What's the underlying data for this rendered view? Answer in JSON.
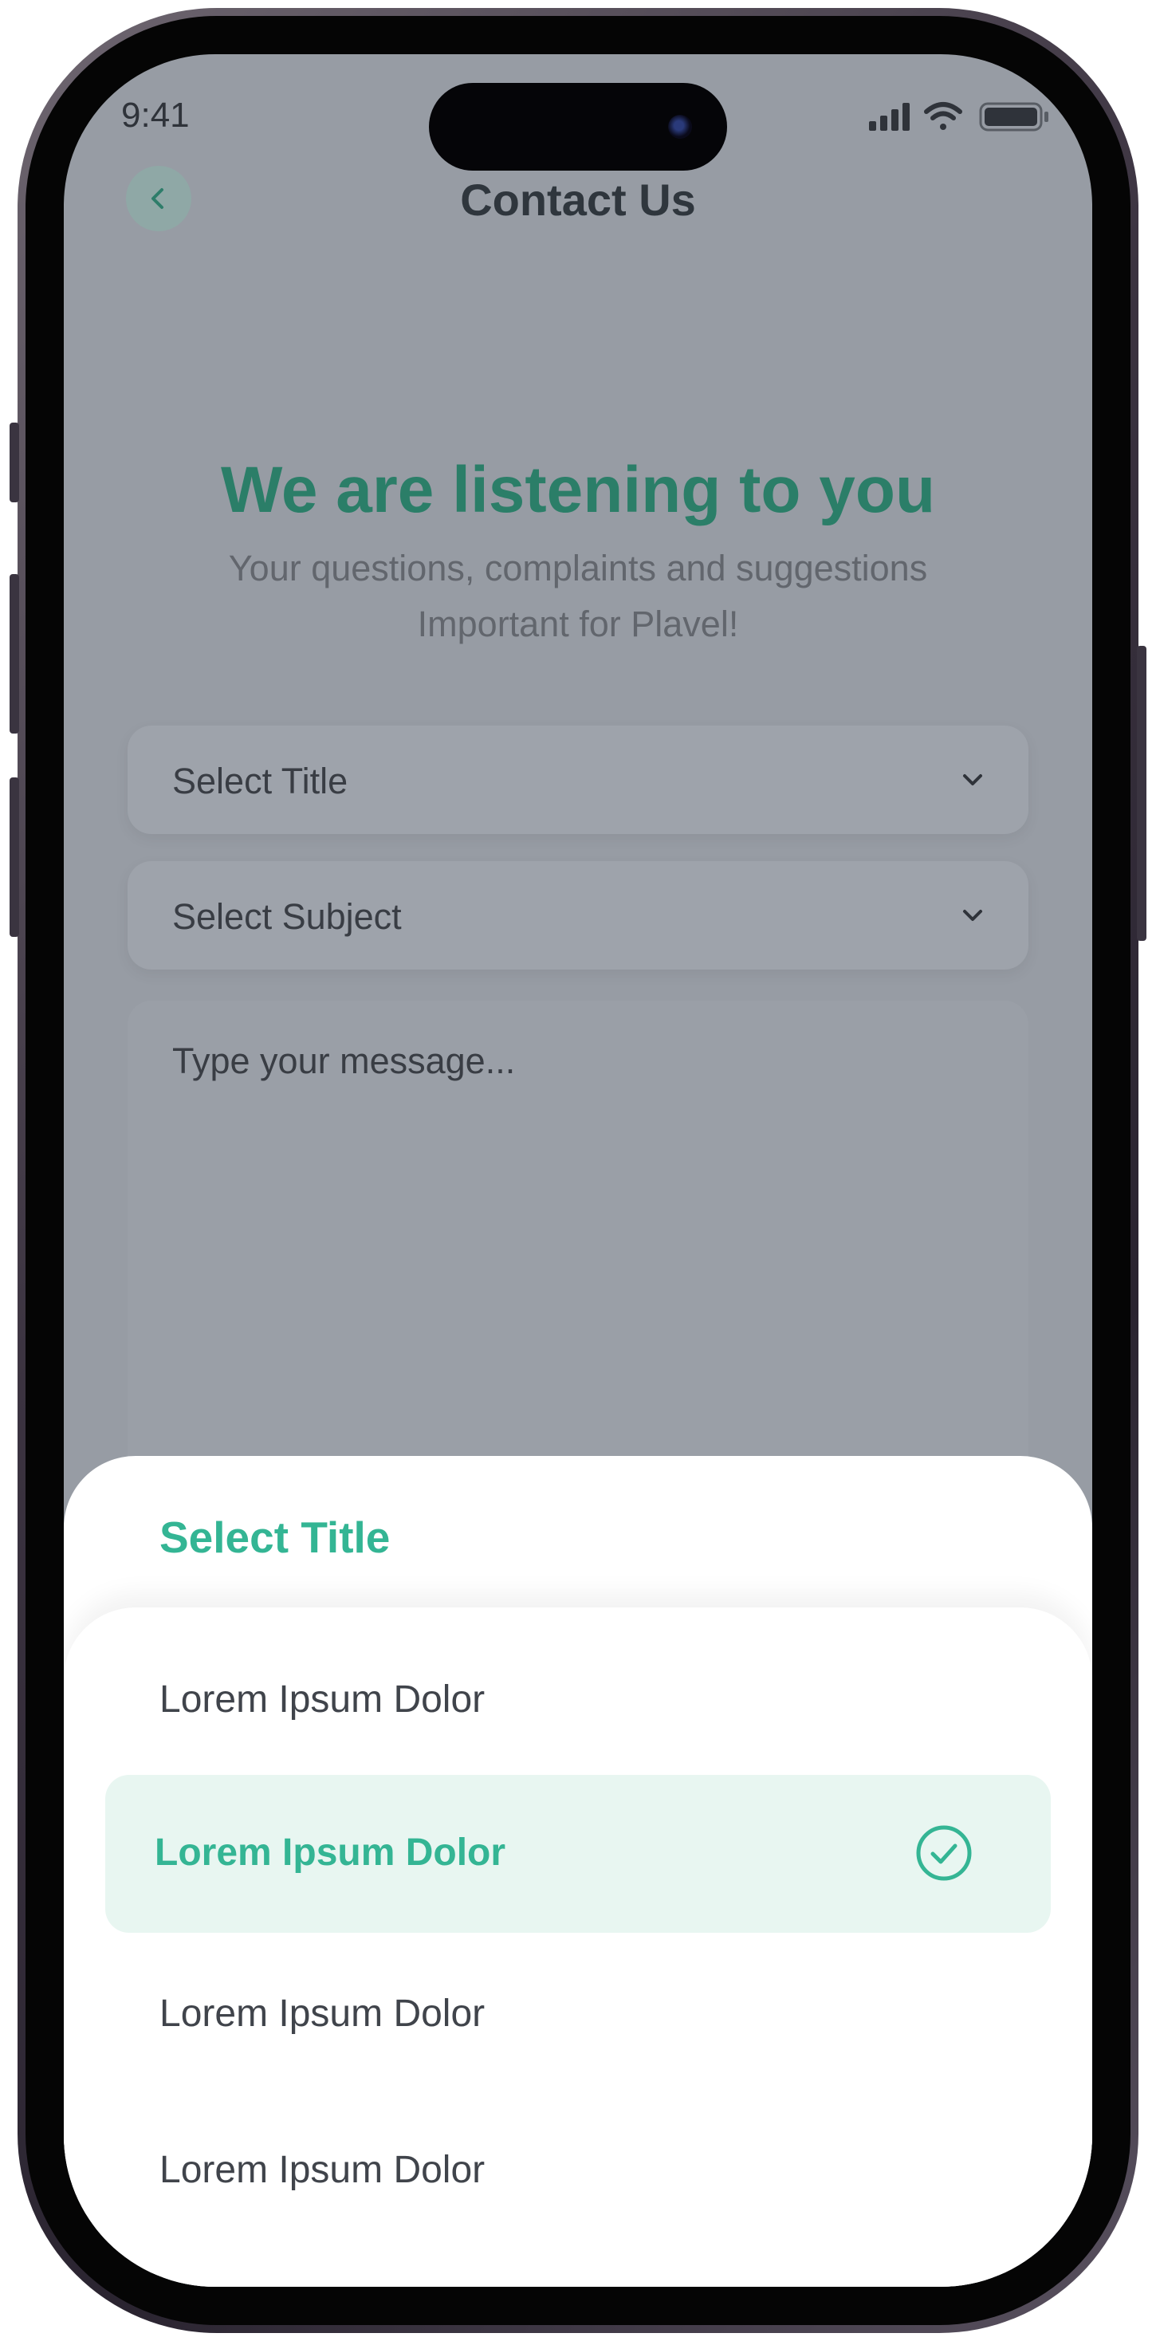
{
  "status_bar": {
    "time": "9:41"
  },
  "nav": {
    "title": "Contact Us"
  },
  "hero": {
    "title": "We are listening to you",
    "subtitle_line1": "Your questions, complaints and suggestions",
    "subtitle_line2": "Important for Plavel!"
  },
  "form": {
    "title_select": "Select Title",
    "subject_select": "Select Subject",
    "message_placeholder": "Type your message..."
  },
  "sheet": {
    "title": "Select Title",
    "options": [
      {
        "label": "Lorem Ipsum Dolor",
        "selected": false
      },
      {
        "label": "Lorem Ipsum Dolor",
        "selected": true
      },
      {
        "label": "Lorem Ipsum Dolor",
        "selected": false
      },
      {
        "label": "Lorem Ipsum Dolor",
        "selected": false
      }
    ]
  },
  "colors": {
    "accent": "#34b594",
    "accent_dark": "#2b7e68",
    "selected_bg": "#e8f6f1",
    "overlay": "#979ca4"
  },
  "icons": [
    "back-arrow-icon",
    "signal-icon",
    "wifi-icon",
    "battery-icon",
    "chevron-down-icon",
    "check-circle-icon"
  ]
}
